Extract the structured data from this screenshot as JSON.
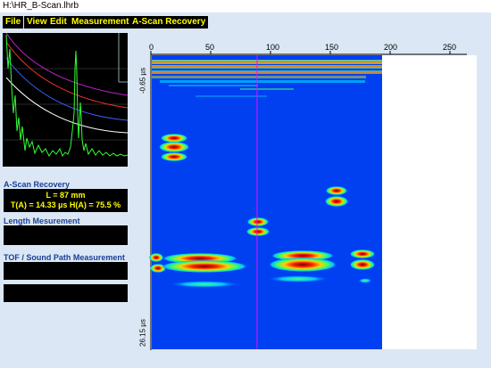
{
  "window": {
    "title": "H:\\HR_B-Scan.lhrb"
  },
  "menu": [
    {
      "label": "File"
    },
    {
      "label": "View"
    },
    {
      "label": "Edit"
    },
    {
      "label": "Measurements"
    },
    {
      "label": "A-Scan Recovery"
    }
  ],
  "sidebar": {
    "ascan_recovery": {
      "title": "A-Scan Recovery",
      "line1": "L = 87 mm",
      "line2": "T(A) = 14.33 µs     H(A) = 75.5 %"
    },
    "length_measurement": {
      "title": "Length Mesurement"
    },
    "tof_measurement": {
      "title": "TOF / Sound Path Measurement"
    }
  },
  "bscan": {
    "x_ticks": [
      "0",
      "50",
      "100",
      "150",
      "200",
      "250"
    ],
    "y_top": "-0.65 µs",
    "y_bottom": "26.15 µs",
    "cursor_position": 87,
    "colors": {
      "background": "#0000ff",
      "data_bg": "#0033ee",
      "empty": "#ffffff",
      "cursor": "#ff00ff"
    }
  }
}
